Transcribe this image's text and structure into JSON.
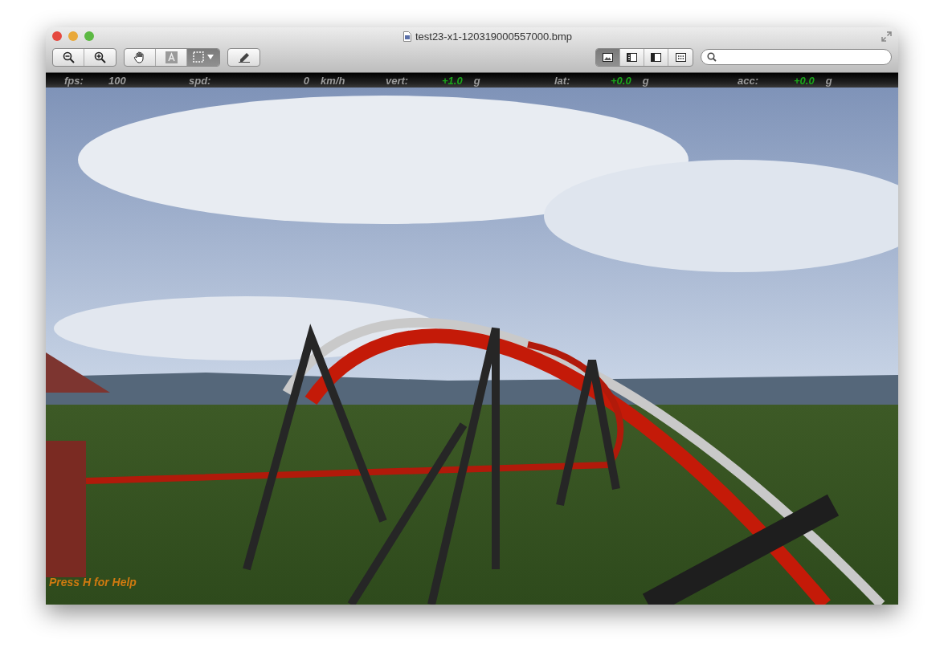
{
  "window": {
    "title": "test23-x1-120319000557000.bmp"
  },
  "tool_groups": [
    {
      "tools": [
        {
          "kind": "zoom-out",
          "selected": false
        },
        {
          "kind": "zoom-in",
          "selected": false
        }
      ]
    },
    {
      "tools": [
        {
          "kind": "hand",
          "selected": false
        },
        {
          "kind": "text",
          "selected": false
        },
        {
          "kind": "select",
          "selected": true
        }
      ]
    },
    {
      "tools": [
        {
          "kind": "pencil",
          "selected": false
        }
      ]
    }
  ],
  "view_modes": [
    {
      "kind": "content",
      "selected": true
    },
    {
      "kind": "thumbnails",
      "selected": false
    },
    {
      "kind": "sidebar",
      "selected": false
    },
    {
      "kind": "contact-sheet",
      "selected": false
    }
  ],
  "hud": [
    {
      "label": "fps:",
      "value": "100",
      "kind": "plain"
    },
    {
      "label": "spd:",
      "value": "0",
      "unit": "km/h",
      "kind": "plain"
    },
    {
      "label": "vert:",
      "value": "+1.0",
      "unit": "g",
      "kind": "force"
    },
    {
      "label": "lat:",
      "value": "+0.0",
      "unit": "g",
      "kind": "force"
    },
    {
      "label": "acc:",
      "value": "+0.0",
      "unit": "g",
      "kind": "force"
    }
  ],
  "help_hint": "Press H for Help"
}
